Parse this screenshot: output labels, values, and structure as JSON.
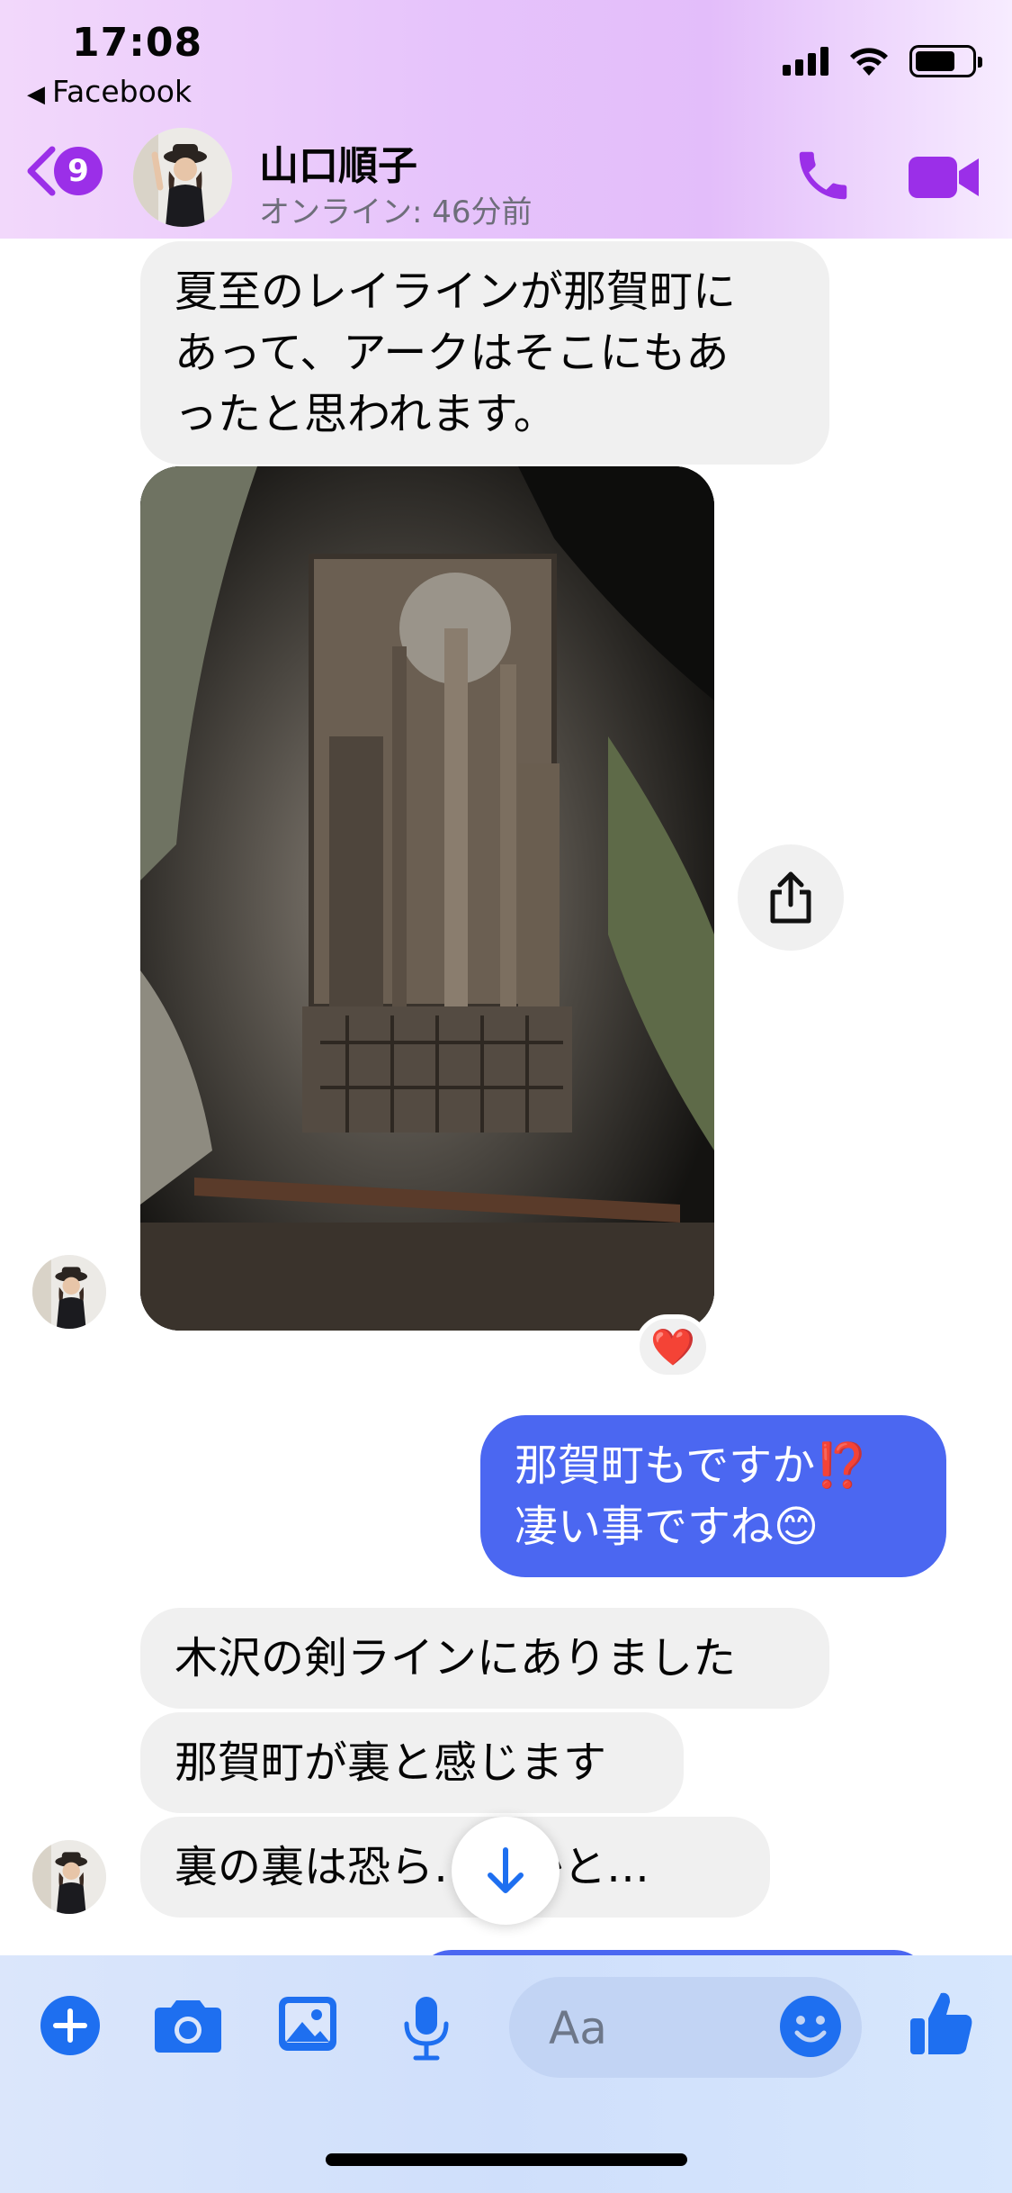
{
  "status_bar": {
    "time": "17:08",
    "back_app": "Facebook"
  },
  "header": {
    "unread_count": "9",
    "contact_name": "山口順子",
    "contact_status": "オンライン: 46分前"
  },
  "messages": {
    "m1": {
      "line1": "夏至のレイラインが那賀町に",
      "line2": "あって、アークはそこにもあ",
      "line3": "ったと思われます。"
    },
    "photo_reaction": "❤️",
    "m2": {
      "line1": "那賀町もですか⁉️",
      "line2": "凄い事ですね😊"
    },
    "m3": "木沢の剣ラインにありました",
    "m4": "那賀町が裏と感じます",
    "m5": "裏の裏は恐ら…球かと…"
  },
  "composer": {
    "placeholder": "Aa"
  },
  "colors": {
    "accent_purple": "#9b2fe8",
    "outgoing_bubble": "#4b67f1",
    "icon_blue": "#1e6ff0"
  }
}
